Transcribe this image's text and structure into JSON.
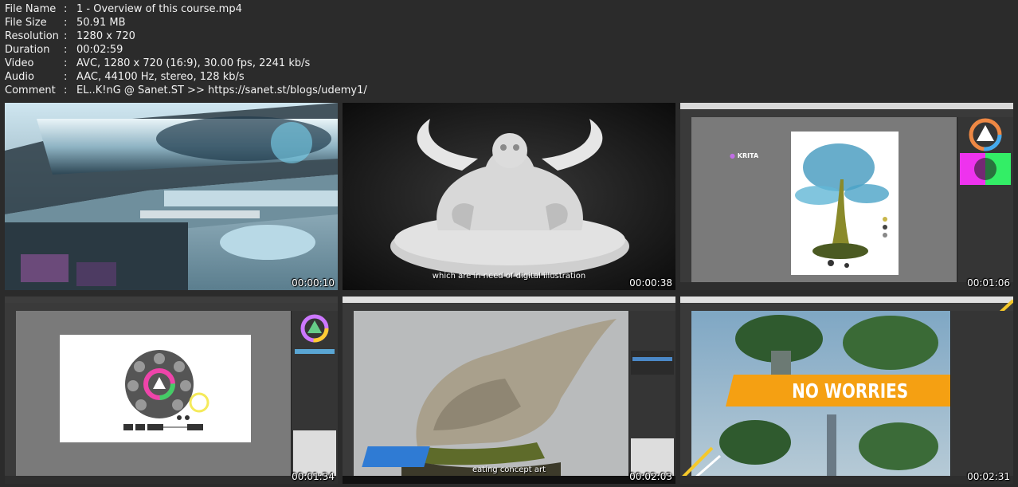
{
  "file_info": {
    "rows": [
      {
        "key": "File Name",
        "value": "1 - Overview of this course.mp4"
      },
      {
        "key": "File Size",
        "value": "50.91 MB"
      },
      {
        "key": "Resolution",
        "value": "1280 x 720"
      },
      {
        "key": "Duration",
        "value": "00:02:59"
      },
      {
        "key": "Video",
        "value": "AVC, 1280 x 720 (16:9), 30.00 fps, 2241 kb/s"
      },
      {
        "key": "Audio",
        "value": "AAC, 44100 Hz, stereo, 128 kb/s"
      },
      {
        "key": "Comment",
        "value": "EL..K!nG @ Sanet.ST >> https://sanet.st/blogs/udemy1/"
      }
    ],
    "separator": ":"
  },
  "thumbnails": [
    {
      "timestamp": "00:00:10"
    },
    {
      "timestamp": "00:00:38",
      "subtitle": "which are in need of digital illustration"
    },
    {
      "timestamp": "00:01:06",
      "logo": "KRITA"
    },
    {
      "timestamp": "00:01:34"
    },
    {
      "timestamp": "00:02:03",
      "subtitle": "eating concept art"
    },
    {
      "timestamp": "00:02:31",
      "banner": "NO WORRIES"
    }
  ]
}
